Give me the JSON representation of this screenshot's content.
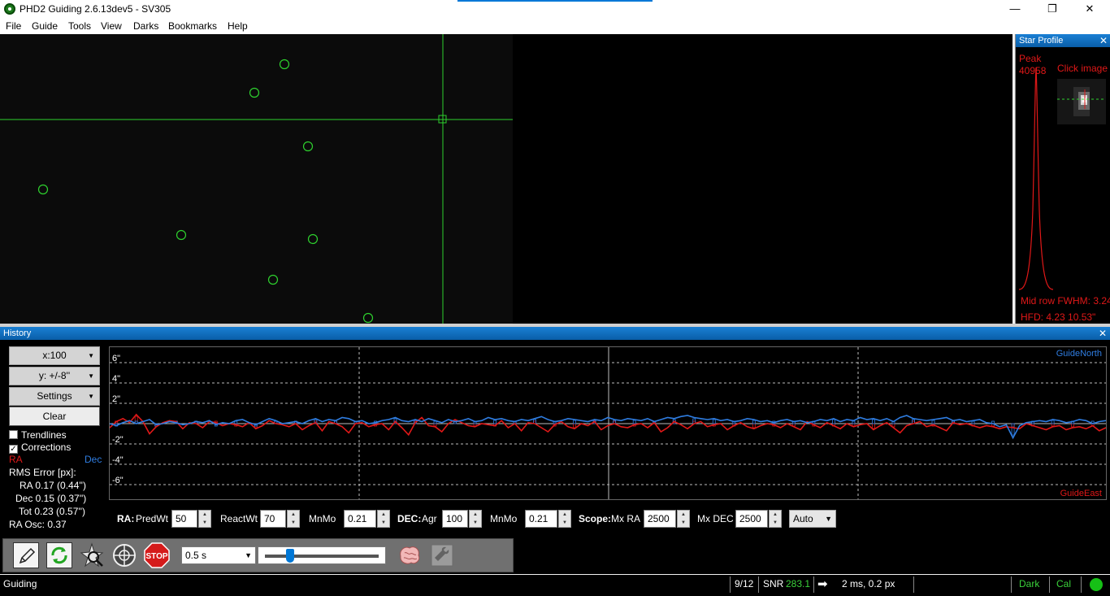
{
  "window": {
    "title": "PHD2 Guiding 2.6.13dev5 - SV305",
    "controls": {
      "minimize": "—",
      "maximize": "❐",
      "close": "✕"
    }
  },
  "menu": {
    "items": [
      "File",
      "Guide",
      "Tools",
      "View",
      "Darks",
      "Bookmarks",
      "Help"
    ]
  },
  "star_profile": {
    "title": "Star Profile",
    "close": "✕",
    "peak_label": "Peak",
    "peak_value": "40958",
    "click_text": "Click image",
    "fwhm_text": "Mid row FWHM: 3.24",
    "hfd_text": "HFD: 4.23  10.53\""
  },
  "history": {
    "title": "History",
    "close": "✕",
    "x_scale": "x:100",
    "y_scale": "y: +/-8''",
    "settings_label": "Settings",
    "clear_label": "Clear",
    "trendlines_label": "Trendlines",
    "trendlines_checked": false,
    "corrections_label": "Corrections",
    "corrections_checked": true,
    "ra_label": "RA",
    "dec_label": "Dec",
    "rms_header": "RMS Error [px]:",
    "rms_ra": "RA  0.17 (0.44'')",
    "rms_dec": "Dec  0.15 (0.37'')",
    "rms_tot": "Tot  0.23 (0.57'')",
    "ra_osc": "RA Osc: 0.37",
    "guide_north": "GuideNorth",
    "guide_east": "GuideEast",
    "colors": {
      "ra": "#e01818",
      "dec": "#2f7de1"
    }
  },
  "chart_data": {
    "type": "line",
    "ylim": [
      -8,
      8
    ],
    "y_ticks": [
      "6\"",
      "4\"",
      "2\"",
      "-2\"",
      "-4\"",
      "-6\""
    ],
    "y_tick_values": [
      6,
      4,
      2,
      -2,
      -4,
      -6
    ],
    "series": [
      {
        "name": "RA",
        "color": "#e01818",
        "values": [
          -0.4,
          0.2,
          0.5,
          0.1,
          0.9,
          0.2,
          -1.0,
          -0.3,
          0.1,
          0.3,
          0.2,
          -0.5,
          0.1,
          0.0,
          -0.4,
          0.2,
          0.1,
          -0.2,
          0.0,
          -0.1,
          -0.3,
          0.1,
          -0.5,
          -0.2,
          0.3,
          0.0,
          -0.1,
          -0.3,
          0.0,
          -0.6,
          -0.2,
          0.1,
          -0.7,
          0.2,
          0.0,
          -0.3,
          -0.9,
          0.0,
          0.1,
          -0.3,
          -0.1,
          0.0,
          -0.6,
          0.2,
          -0.4,
          -1.1,
          0.1,
          0.6,
          -0.2,
          -0.3,
          -0.8,
          0.0,
          0.4,
          0.1,
          -0.2,
          -0.3,
          0.0,
          -0.1,
          -0.2,
          0.3,
          -0.4,
          0.0,
          -0.7,
          0.1,
          0.0,
          -0.4,
          -0.8,
          -0.1,
          0.2,
          -0.3,
          -0.5,
          0.0,
          -0.2,
          0.2,
          -0.6,
          -0.2,
          0.0,
          -0.3,
          -0.4,
          -0.1,
          0.0,
          -0.4,
          0.1,
          -0.8,
          -0.4,
          0.2,
          -0.1,
          -0.5,
          0.0,
          0.2,
          -0.3,
          -0.1,
          0.0,
          -0.6,
          -0.2,
          0.1,
          -0.3,
          -0.5,
          -0.2,
          0.0,
          -0.1,
          -0.4,
          0.0,
          -0.3,
          -0.6,
          0.2,
          -0.1,
          -0.4,
          0.1,
          -0.2,
          -0.5,
          0.0,
          -0.3,
          -0.1,
          0.0,
          -0.6,
          -0.2,
          0.1,
          -0.4,
          -0.9,
          -0.2,
          0.0,
          0.2,
          -0.3,
          -0.1,
          -0.4,
          -0.7,
          0.1,
          -0.1,
          0.0,
          -0.2,
          -0.4,
          -0.2,
          -0.3,
          -0.5,
          -0.3,
          -0.4,
          -0.5,
          0.0,
          -0.2,
          -0.4,
          -0.6,
          -0.3,
          -0.2,
          -0.6,
          -0.4,
          -0.3,
          -0.5,
          -0.2,
          -0.7,
          -0.4
        ]
      },
      {
        "name": "Dec",
        "color": "#2f7de1",
        "values": [
          0.0,
          -0.2,
          0.1,
          0.3,
          0.0,
          0.2,
          0.4,
          -0.1,
          0.0,
          0.2,
          0.1,
          -0.1,
          0.0,
          0.2,
          0.1,
          0.3,
          -0.1,
          0.1,
          0.0,
          0.3,
          0.4,
          0.1,
          -0.1,
          0.2,
          0.5,
          0.3,
          0.0,
          0.1,
          0.2,
          0.0,
          0.3,
          0.5,
          0.2,
          0.4,
          0.3,
          0.6,
          0.5,
          0.2,
          0.3,
          0.0,
          0.1,
          0.3,
          0.4,
          0.6,
          0.3,
          0.2,
          0.4,
          0.2,
          0.5,
          0.3,
          0.1,
          0.4,
          0.2,
          0.3,
          0.5,
          0.2,
          0.3,
          0.6,
          0.4,
          0.5,
          0.3,
          0.2,
          0.4,
          0.3,
          0.5,
          0.7,
          0.4,
          0.2,
          0.3,
          0.5,
          0.4,
          0.3,
          0.2,
          0.4,
          0.3,
          0.6,
          0.4,
          0.3,
          0.5,
          0.4,
          0.3,
          0.5,
          0.2,
          0.4,
          0.6,
          0.5,
          0.7,
          0.8,
          0.6,
          0.5,
          0.4,
          0.5,
          0.3,
          0.4,
          0.2,
          0.3,
          0.5,
          0.4,
          0.2,
          0.3,
          0.1,
          0.3,
          0.4,
          0.2,
          0.3,
          0.1,
          0.2,
          0.4,
          0.3,
          0.5,
          0.2,
          0.4,
          0.3,
          0.6,
          0.4,
          0.5,
          0.3,
          0.5,
          0.2,
          0.6,
          0.8,
          0.5,
          0.4,
          0.3,
          0.4,
          0.5,
          0.6,
          0.3,
          0.4,
          0.2,
          0.3,
          0.4,
          0.1,
          0.0,
          -0.3,
          -0.1,
          -1.4,
          -0.2,
          0.1,
          0.2,
          0.3,
          0.2,
          0.4,
          0.3,
          0.1,
          0.2,
          0.4,
          0.3,
          0.0,
          0.2,
          0.3
        ]
      }
    ]
  },
  "params": {
    "ra_header": "RA:",
    "pred_wt_label": "PredWt",
    "pred_wt": "50",
    "react_wt_label": "ReactWt",
    "react_wt": "70",
    "ra_mnmo_label": "MnMo",
    "ra_mnmo": "0.21",
    "dec_header": "DEC:",
    "agr_label": "Agr",
    "agr": "100",
    "dec_mnmo_label": "MnMo",
    "dec_mnmo": "0.21",
    "scope_header": "Scope:",
    "mx_ra_label": "Mx RA",
    "mx_ra": "2500",
    "mx_dec_label": "Mx DEC",
    "mx_dec": "2500",
    "dec_mode": "Auto"
  },
  "toolbar": {
    "exposure": "0.5 s",
    "stop_label": "STOP",
    "gamma_level": 0.2
  },
  "status": {
    "state": "Guiding",
    "frame": "9/12",
    "snr_label": "SNR",
    "snr_value": "283.1",
    "pulse": "2 ms, 0.2 px",
    "dark": "Dark",
    "cal": "Cal"
  }
}
